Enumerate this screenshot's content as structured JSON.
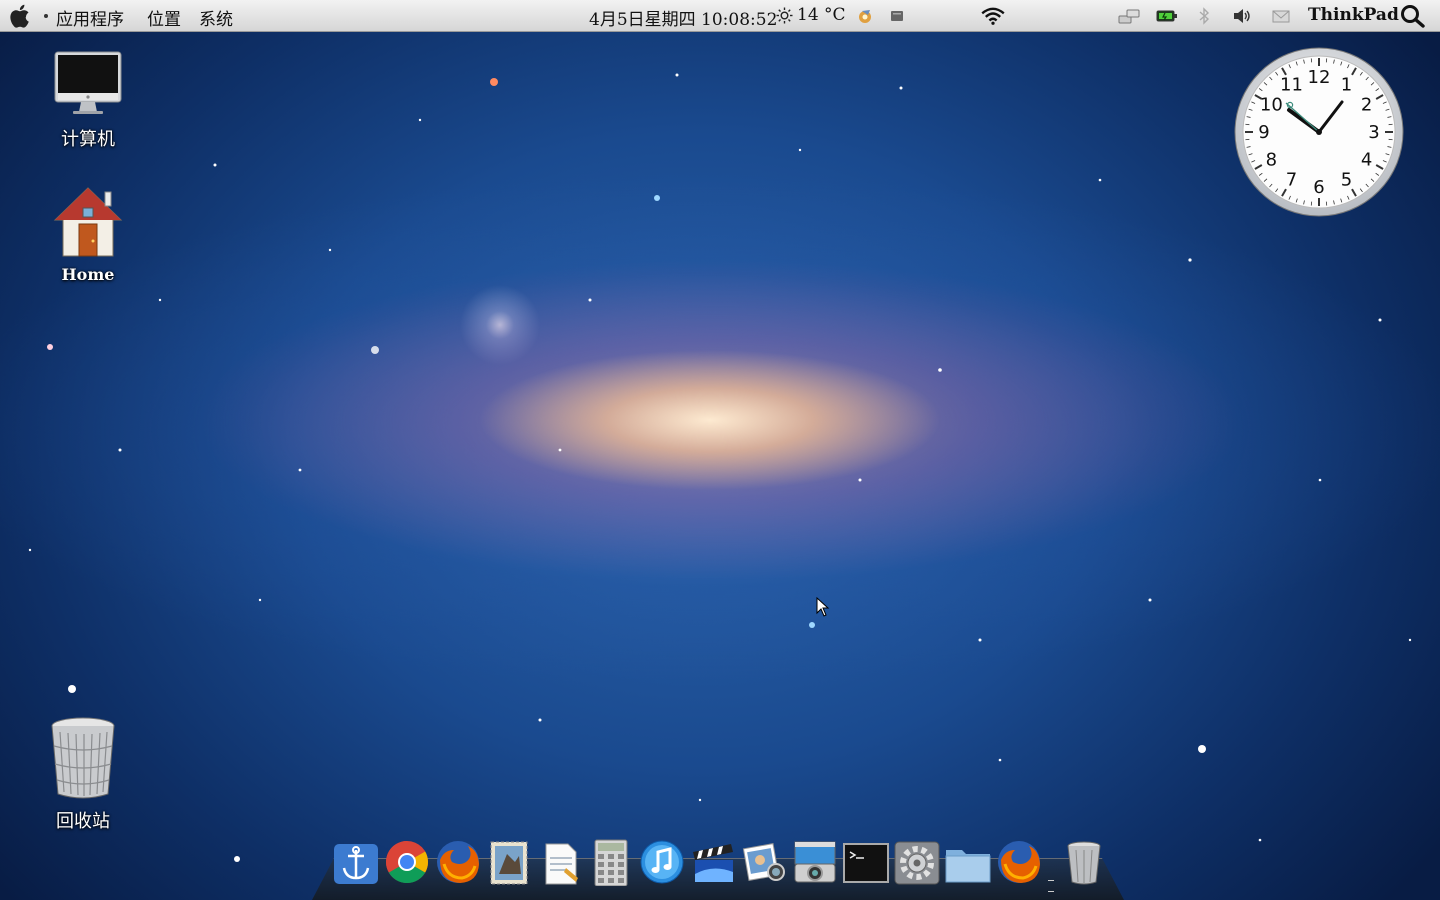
{
  "menubar": {
    "apple_icon": "apple-logo-icon",
    "menus": [
      "应用程序",
      "位置",
      "系统"
    ],
    "datetime": "4月5日星期四 10:08:52",
    "weather_icon": "sun-icon",
    "temperature": "14 °C",
    "tray_icons": [
      "rhythmbox-icon",
      "notes-icon",
      "wifi-icon",
      "network-icon",
      "battery-icon",
      "bluetooth-icon",
      "volume-icon",
      "mail-icon"
    ],
    "hostname": "ThinkPad",
    "search_icon": "spotlight-search-icon"
  },
  "desktop": {
    "icons": [
      {
        "label": "计算机",
        "icon": "computer-icon"
      },
      {
        "label": "Home",
        "icon": "home-folder-icon"
      },
      {
        "label": "回收站",
        "icon": "trash-icon"
      }
    ]
  },
  "clock_widget": {
    "numbers": [
      "12",
      "1",
      "2",
      "3",
      "4",
      "5",
      "6",
      "7",
      "8",
      "9",
      "10",
      "11"
    ],
    "time": "10:08"
  },
  "dock": {
    "items": [
      "anchor-icon",
      "chrome-icon",
      "firefox-icon",
      "mail-stamp-icon",
      "text-editor-icon",
      "calculator-icon",
      "itunes-icon",
      "video-editor-icon",
      "photo-viewer-icon",
      "screenshot-camera-icon",
      "terminal-icon",
      "system-settings-icon",
      "folder-icon",
      "firefox-icon",
      "trash-icon"
    ]
  },
  "colors": {
    "menubar_top": "#f2f2f2",
    "menubar_bottom": "#d6d6d6",
    "wallpaper_deep": "#0e2f66",
    "wallpaper_light": "#2b64ad"
  }
}
